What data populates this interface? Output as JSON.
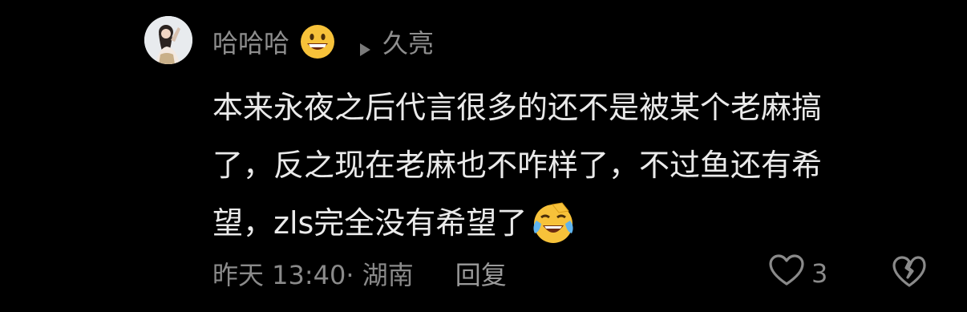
{
  "comment": {
    "username": "哈哈哈",
    "reply_to": "久亮",
    "text_lines": [
      "本来永夜之后代言很多的还不是被某个老麻搞",
      "了，反之现在老麻也不咋样了，不过鱼还有希",
      "望，zls完全没有希望了"
    ],
    "time": "昨天 13:40",
    "location": "· 湖南",
    "reply_label": "回复",
    "like_count": "3"
  },
  "icons": {
    "username_emoji": "grinning-face-icon",
    "reply_arrow": "play-triangle-icon",
    "text_emoji": "laughing-crying-face-icon",
    "like": "heart-outline-icon",
    "dislike": "broken-heart-icon"
  },
  "colors": {
    "background": "#000000",
    "text": "#eaeaea",
    "muted": "#8a8a8a",
    "emoji_yellow": "#f7c23a"
  }
}
